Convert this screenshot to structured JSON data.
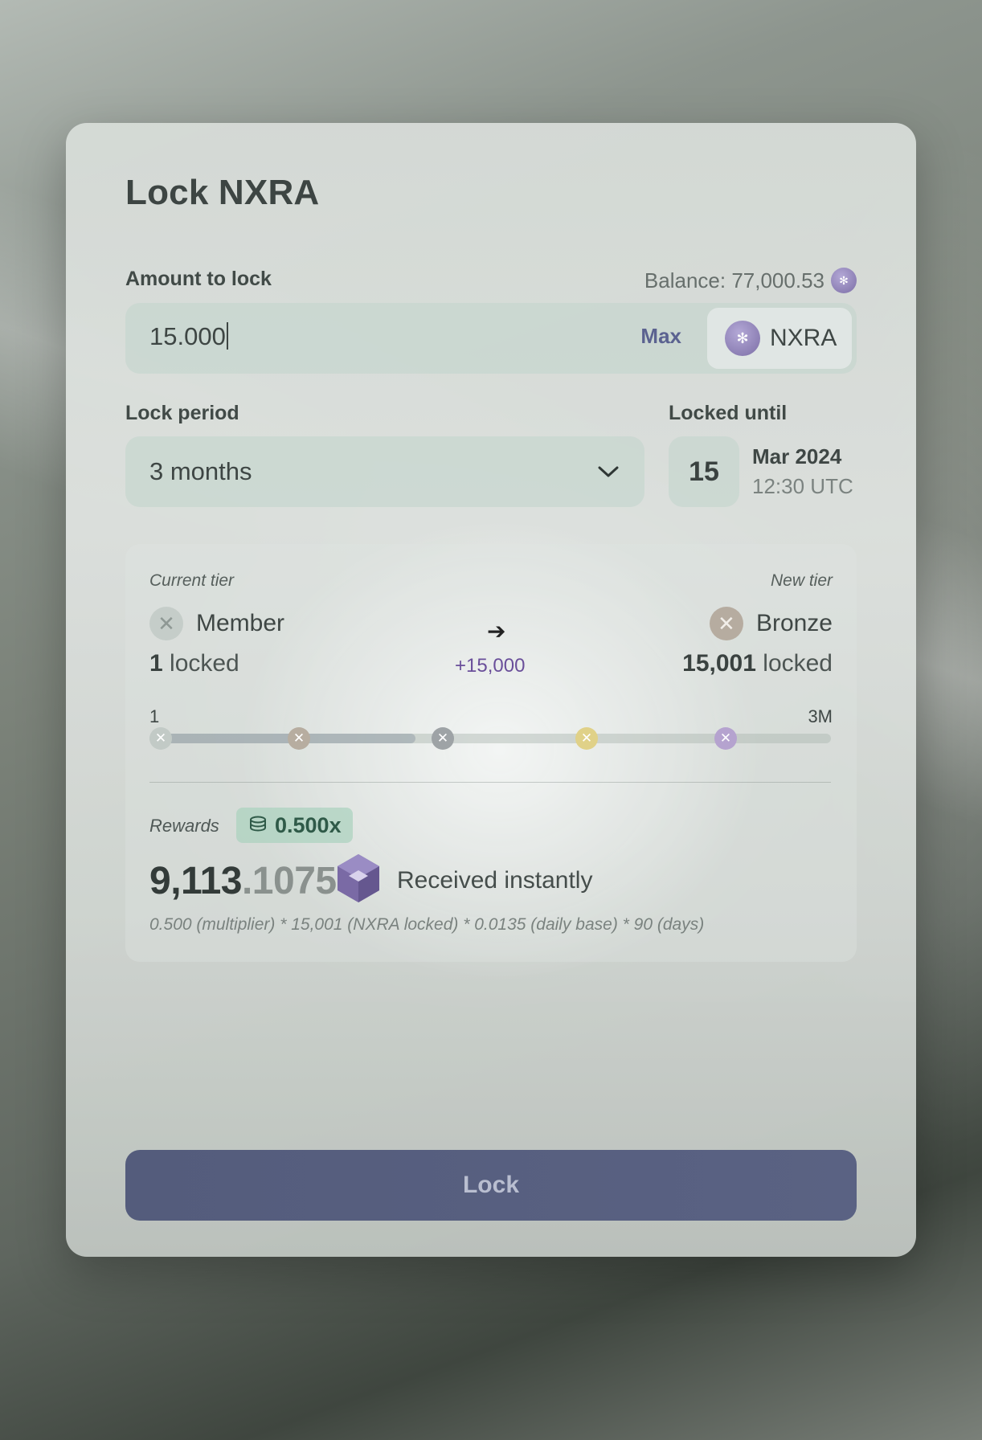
{
  "dialog": {
    "title": "Lock NXRA",
    "amount": {
      "label": "Amount to lock",
      "balance": "Balance: 77,000.53",
      "value": "15.000",
      "max_label": "Max",
      "token": "NXRA"
    },
    "lock_period": {
      "label": "Lock period",
      "selected": "3 months"
    },
    "locked_until": {
      "label": "Locked until",
      "day": "15",
      "month_year": "Mar 2024",
      "time": "12:30 UTC"
    },
    "tier": {
      "current_label": "Current tier",
      "current_name": "Member",
      "current_locked_num": "1",
      "current_locked_suffix": " locked",
      "new_label": "New tier",
      "new_name": "Bronze",
      "new_locked_num": "15,001",
      "new_locked_suffix": " locked",
      "delta": "+15,000",
      "scale_min": "1",
      "scale_max": "3M",
      "progress_fraction": 0.39,
      "markers": [
        {
          "name": "member",
          "color": "#c2cac6"
        },
        {
          "name": "bronze",
          "color": "#b7ada0"
        },
        {
          "name": "silver",
          "color": "#9ea3a6"
        },
        {
          "name": "gold",
          "color": "#e0d188"
        },
        {
          "name": "platinum",
          "color": "#b5a3cf"
        }
      ]
    },
    "rewards": {
      "label": "Rewards",
      "multiplier": "0.500x",
      "amount_int": "9,113",
      "amount_dec": ".1075",
      "received": "Received instantly",
      "formula": "0.500 (multiplier) * 15,001 (NXRA locked) * 0.0135 (daily base) * 90 (days)"
    },
    "lock_button": "Lock"
  },
  "colors": {
    "accent": "#5a6283",
    "delta": "#6a4f9a",
    "multiplier_bg": "#aad2be"
  }
}
